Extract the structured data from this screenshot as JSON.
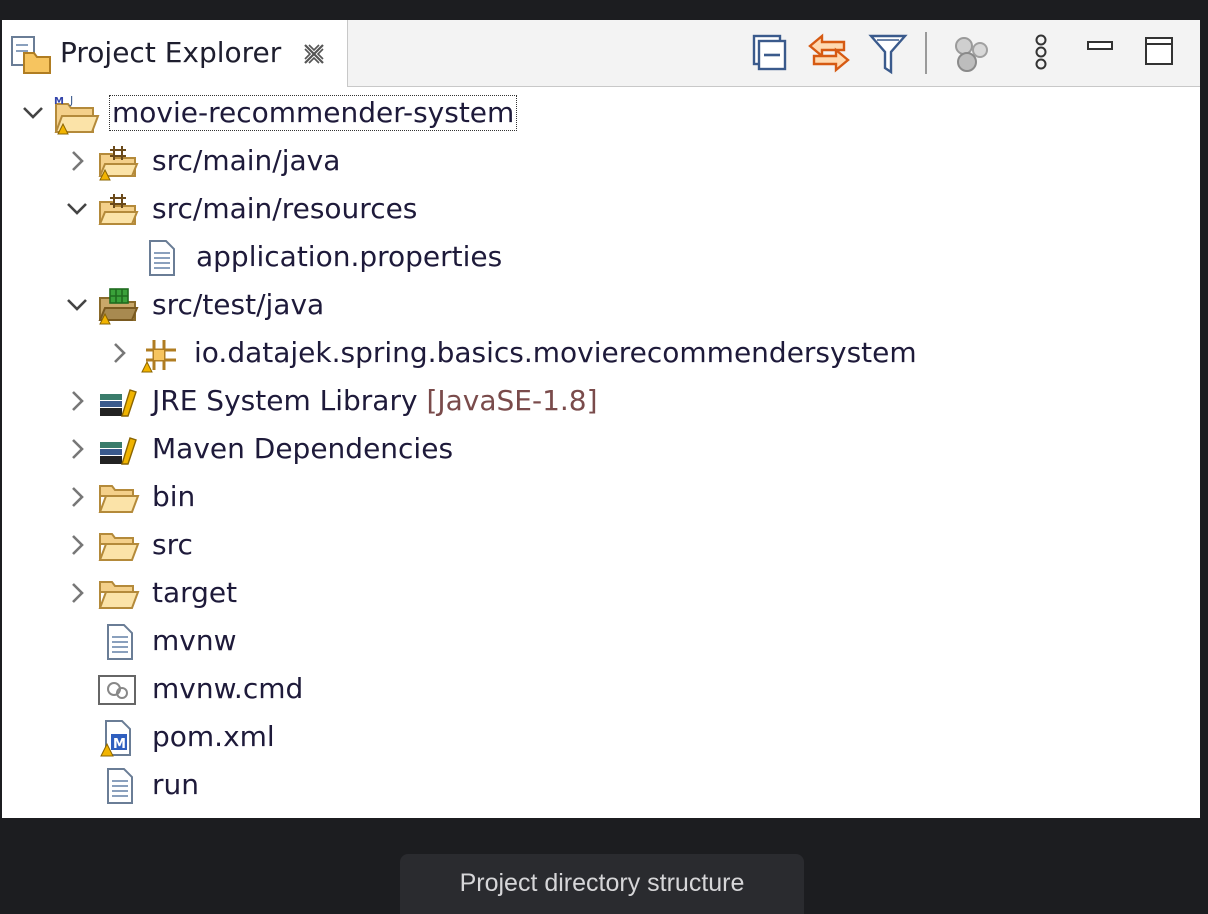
{
  "view": {
    "tab_title": "Project Explorer",
    "tab_icon": "package-explorer-icon",
    "close_icon": "close-icon",
    "toolbar": [
      {
        "name": "collapse-all-icon"
      },
      {
        "name": "link-with-editor-icon"
      },
      {
        "name": "filter-icon"
      },
      {
        "name": "working-sets-icon"
      },
      {
        "name": "view-menu-icon"
      },
      {
        "name": "minimize-icon"
      },
      {
        "name": "maximize-icon"
      }
    ]
  },
  "tree": {
    "root": "movie-recommender-system",
    "src_main_java": "src/main/java",
    "src_main_resources": "src/main/resources",
    "application_properties": "application.properties",
    "src_test_java": "src/test/java",
    "test_package": "io.datajek.spring.basics.movierecommendersystem",
    "jre_library": "JRE System Library",
    "jre_decoration": "[JavaSE-1.8]",
    "maven_dependencies": "Maven Dependencies",
    "bin": "bin",
    "src": "src",
    "target": "target",
    "mvnw": "mvnw",
    "mvnw_cmd": "mvnw.cmd",
    "pom_xml": "pom.xml",
    "run": "run"
  },
  "caption": "Project directory structure",
  "colors": {
    "background": "#1c1d20",
    "panel": "#ffffff",
    "text": "#1e1a3a",
    "decoration": "#7a4b4b",
    "folder": "#f4d08a",
    "accent": "#3f7fbf"
  }
}
